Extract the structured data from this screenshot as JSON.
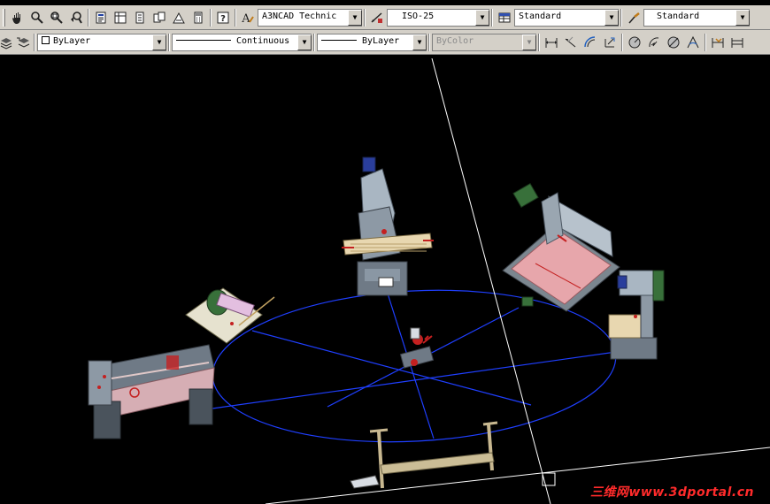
{
  "toolbar_top": {
    "text_style": "A3NCAD Technic",
    "dim_style": "ISO-25",
    "table_style": "Standard",
    "multileader_style": "Standard"
  },
  "toolbar_properties": {
    "layer_color": "ByLayer",
    "linetype": "Continuous",
    "lineweight": "ByLayer",
    "plot_style": "ByColor"
  },
  "watermark": "三维网www.3dportal.cn",
  "colors": {
    "toolbar_bg": "#d4d0c8",
    "model_space_bg": "#000000",
    "ellipse_line": "#1f3fff",
    "crosshair": "#ffffff",
    "watermark": "#ff2b2b"
  },
  "icons": {
    "toolbar_top": [
      "pan-icon",
      "zoom-realtime-icon",
      "zoom-window-icon",
      "zoom-previous-icon",
      "properties-icon",
      "design-center-icon",
      "tool-palettes-icon",
      "sheet-set-icon",
      "markup-icon",
      "quickcalc-icon",
      "help-icon",
      "text-style-icon",
      "dim-style-icon",
      "table-style-icon",
      "multileader-style-icon"
    ],
    "toolbar_properties": [
      "layer-states-icon",
      "layer-previous-icon",
      "linear-dim-icon",
      "aligned-dim-icon",
      "arc-length-dim-icon",
      "ordinate-dim-icon",
      "radius-dim-icon",
      "jogged-dim-icon",
      "diameter-dim-icon",
      "angular-dim-icon",
      "quick-dim-icon",
      "baseline-dim-icon"
    ]
  }
}
